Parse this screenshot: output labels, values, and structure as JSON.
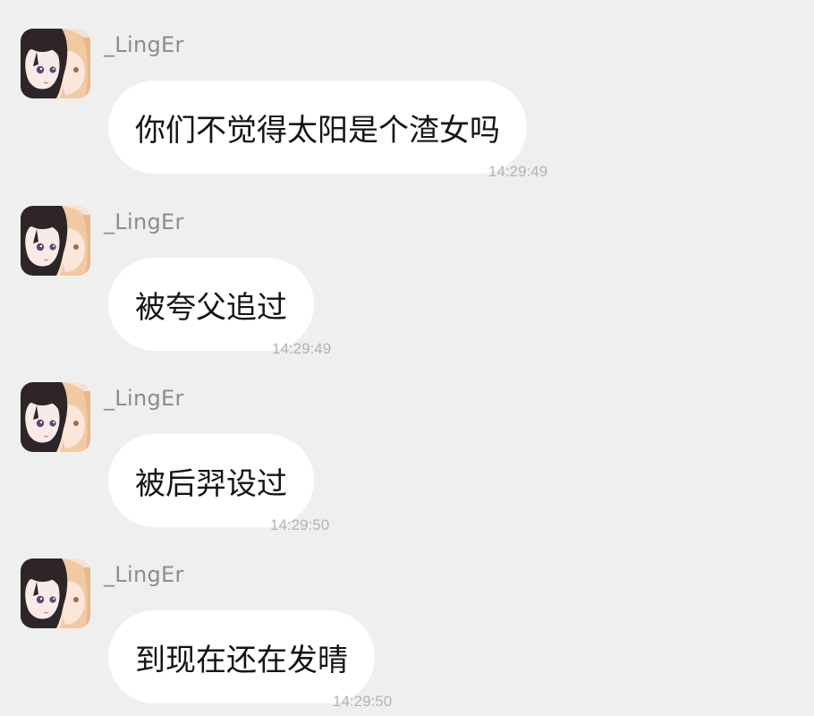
{
  "messages": [
    {
      "sender": "_LingEr",
      "text": "你们不觉得太阳是个渣女吗",
      "time": "14:29:49",
      "avatar_icon": "anime-avatar-icon"
    },
    {
      "sender": "_LingEr",
      "text": "被夸父追过",
      "time": "14:29:49",
      "avatar_icon": "anime-avatar-icon"
    },
    {
      "sender": "_LingEr",
      "text": "被后羿设过",
      "time": "14:29:50",
      "avatar_icon": "anime-avatar-icon"
    },
    {
      "sender": "_LingEr",
      "text": "到现在还在发晴",
      "time": "14:29:50",
      "avatar_icon": "anime-avatar-icon"
    }
  ],
  "colors": {
    "background": "#efefef",
    "bubble": "#ffffff",
    "text": "#151515",
    "username": "#8c8c8c",
    "timestamp": "#b3b3b3"
  }
}
